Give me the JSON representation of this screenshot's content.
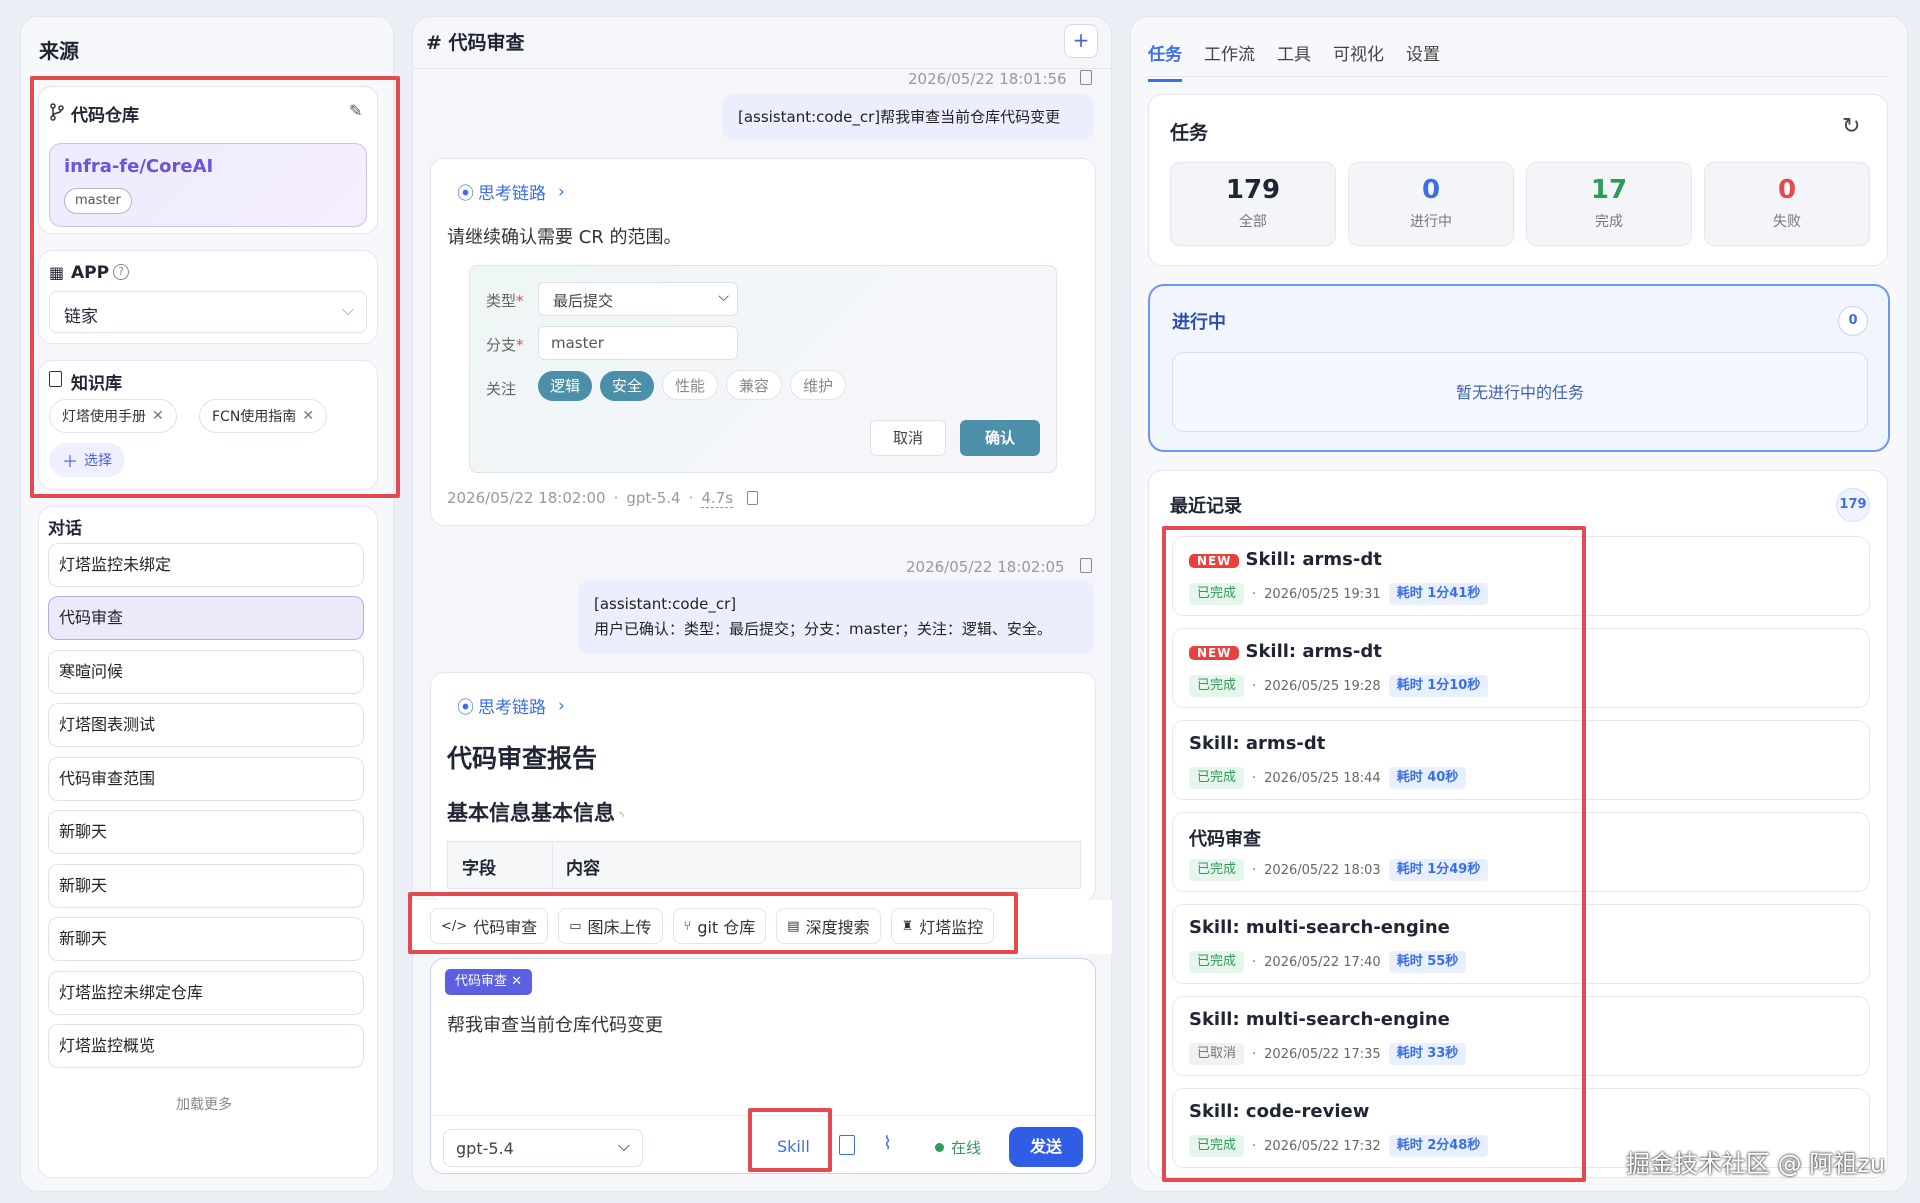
{
  "left": {
    "title": "来源",
    "repo": {
      "label": "代码仓库",
      "name": "infra-fe/CoreAI",
      "branch": "master"
    },
    "app": {
      "label": "APP",
      "value": "链家"
    },
    "kb": {
      "label": "知识库",
      "items": [
        "灯塔使用手册",
        "FCN使用指南"
      ],
      "select_label": "选择"
    },
    "conv": {
      "label": "对话",
      "items": [
        "灯塔监控未绑定",
        "代码审查",
        "寒暄问候",
        "灯塔图表测试",
        "代码审查范围",
        "新聊天",
        "新聊天",
        "新聊天",
        "灯塔监控未绑定仓库",
        "灯塔监控概览"
      ],
      "more": "加载更多"
    }
  },
  "center": {
    "title": "# 代码审查",
    "msg1": {
      "time": "2026/05/22 18:01:56",
      "text": "[assistant:code_cr]帮我审查当前仓库代码变更"
    },
    "reply1": {
      "thinking": "思考链路",
      "text": "请继续确认需要 CR 的范围。",
      "form": {
        "type_label": "类型",
        "type_value": "最后提交",
        "branch_label": "分支",
        "branch_value": "master",
        "focus_label": "关注",
        "focus": [
          "逻辑",
          "安全",
          "性能",
          "兼容",
          "维护"
        ],
        "cancel": "取消",
        "confirm": "确认"
      },
      "time": "2026/05/22 18:02:00",
      "model": "gpt-5.4",
      "elapsed": "4.7s"
    },
    "msg2": {
      "time": "2026/05/22 18:02:05",
      "line1": "[assistant:code_cr]",
      "line2": "用户已确认：类型：最后提交；分支：master；关注：逻辑、安全。"
    },
    "reply2": {
      "thinking": "思考链路",
      "h1": "代码审查报告",
      "h2": "基本信息基本信息",
      "col1": "字段",
      "col2": "内容"
    },
    "tools": [
      "代码审查",
      "图床上传",
      "git 仓库",
      "深度搜索",
      "灯塔监控"
    ],
    "input": {
      "chip": "代码审查",
      "text": "帮我审查当前仓库代码变更",
      "model": "gpt-5.4",
      "skill": "Skill",
      "online": "在线",
      "send": "发送"
    }
  },
  "right": {
    "tabs": [
      "任务",
      "工作流",
      "工具",
      "可视化",
      "设置"
    ],
    "tasks": {
      "title": "任务",
      "stats": [
        {
          "n": "179",
          "l": "全部",
          "color": "#1f2533"
        },
        {
          "n": "0",
          "l": "进行中",
          "color": "#3b6fe6"
        },
        {
          "n": "17",
          "l": "完成",
          "color": "#2e9c56"
        },
        {
          "n": "0",
          "l": "失败",
          "color": "#e24a4f"
        }
      ]
    },
    "running": {
      "title": "进行中",
      "count": "0",
      "empty": "暂无进行中的任务"
    },
    "recent": {
      "title": "最近记录",
      "count": "179",
      "items": [
        {
          "new": "NEW",
          "title": "Skill: arms-dt",
          "status": "已完成",
          "time": "2026/05/25 19:31",
          "dur": "耗时 1分41秒"
        },
        {
          "new": "NEW",
          "title": "Skill: arms-dt",
          "status": "已完成",
          "time": "2026/05/25 19:28",
          "dur": "耗时 1分10秒"
        },
        {
          "new": "",
          "title": "Skill: arms-dt",
          "status": "已完成",
          "time": "2026/05/25 18:44",
          "dur": "耗时 40秒"
        },
        {
          "new": "",
          "title": "代码审查",
          "status": "已完成",
          "time": "2026/05/22 18:03",
          "dur": "耗时 1分49秒"
        },
        {
          "new": "",
          "title": "Skill: multi-search-engine",
          "status": "已完成",
          "time": "2026/05/22 17:40",
          "dur": "耗时 55秒"
        },
        {
          "new": "",
          "title": "Skill: multi-search-engine",
          "status": "已取消",
          "time": "2026/05/22 17:35",
          "dur": "耗时 33秒"
        },
        {
          "new": "",
          "title": "Skill: code-review",
          "status": "已完成",
          "time": "2026/05/22 17:32",
          "dur": "耗时 2分48秒"
        }
      ]
    }
  },
  "watermark": "掘金技术社区 @ 阿祖zu"
}
